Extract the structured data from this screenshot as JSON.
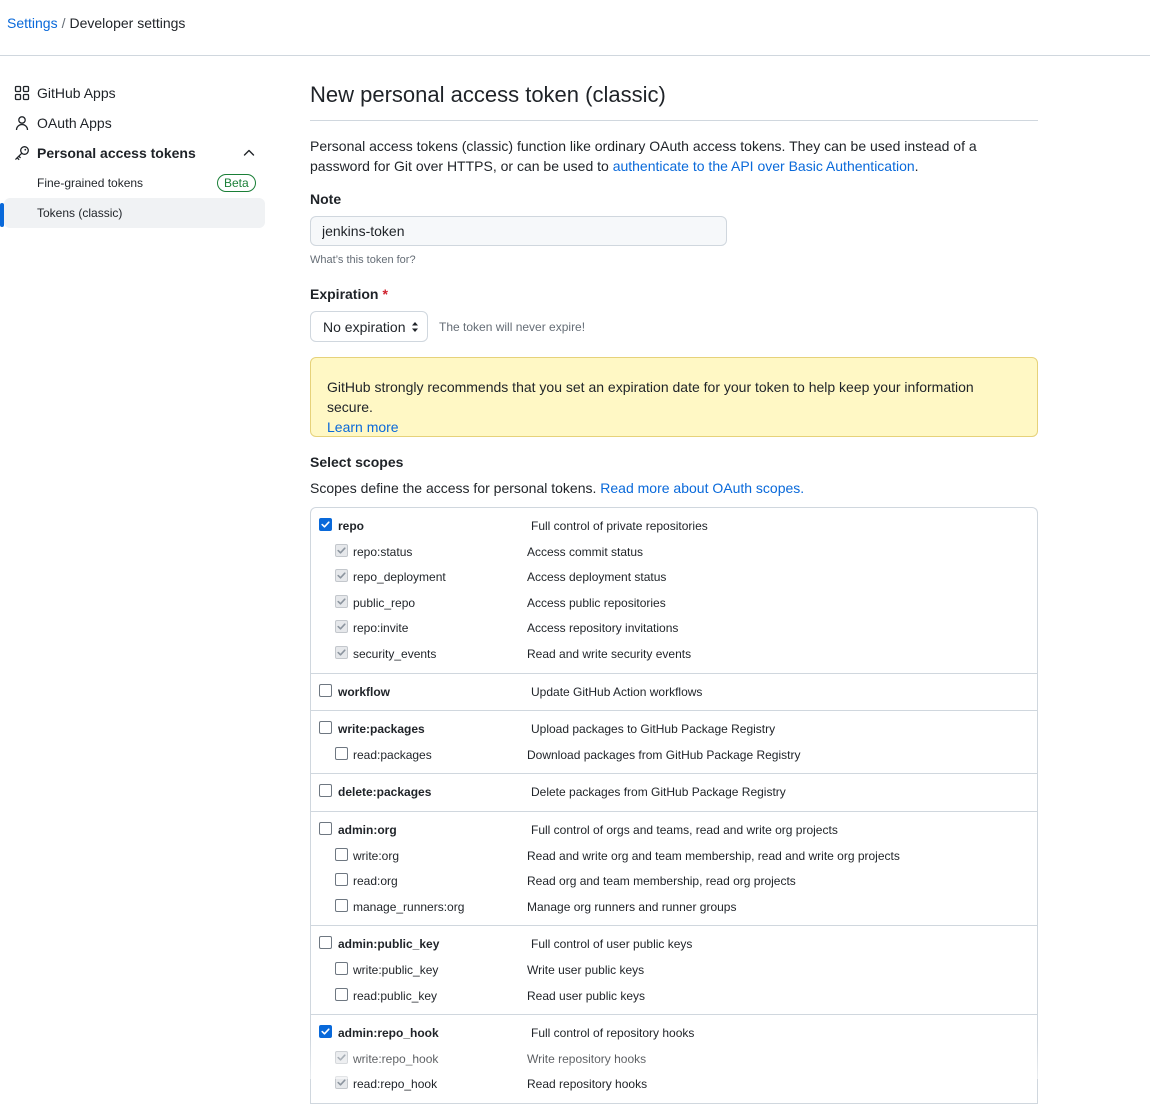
{
  "breadcrumb": {
    "root": "Settings",
    "separator": "/",
    "current": "Developer settings"
  },
  "sidebar": {
    "items": [
      {
        "label": "GitHub Apps",
        "icon": "apps-grid-icon"
      },
      {
        "label": "OAuth Apps",
        "icon": "person-icon"
      },
      {
        "label": "Personal access tokens",
        "icon": "key-icon"
      }
    ],
    "sub_items": [
      {
        "label": "Fine-grained tokens",
        "badge": "Beta"
      },
      {
        "label": "Tokens (classic)"
      }
    ]
  },
  "main": {
    "title": "New personal access token (classic)",
    "intro_text": "Personal access tokens (classic) function like ordinary OAuth access tokens. They can be used instead of a password for Git over HTTPS, or can be used to ",
    "intro_link": "authenticate to the API over Basic Authentication",
    "intro_end": ".",
    "note_label": "Note",
    "note_value": "jenkins-token",
    "note_hint": "What’s this token for?",
    "expiration_label": "Expiration",
    "expiration_required": "*",
    "expiration_value": "No expiration",
    "expiration_note": "The token will never expire!",
    "flash_text": "GitHub strongly recommends that you set an expiration date for your token to help keep your information secure.",
    "flash_link": "Learn more",
    "scopes_title": "Select scopes",
    "scopes_desc": "Scopes define the access for personal tokens. ",
    "scopes_link": "Read more about OAuth scopes."
  },
  "scope_groups": [
    {
      "name": "repo",
      "desc": "Full control of private repositories",
      "checked": true,
      "children": [
        {
          "name": "repo:status",
          "desc": "Access commit status",
          "checked": true
        },
        {
          "name": "repo_deployment",
          "desc": "Access deployment status",
          "checked": true
        },
        {
          "name": "public_repo",
          "desc": "Access public repositories",
          "checked": true
        },
        {
          "name": "repo:invite",
          "desc": "Access repository invitations",
          "checked": true
        },
        {
          "name": "security_events",
          "desc": "Read and write security events",
          "checked": true
        }
      ]
    },
    {
      "name": "workflow",
      "desc": "Update GitHub Action workflows",
      "checked": false,
      "children": []
    },
    {
      "name": "write:packages",
      "desc": "Upload packages to GitHub Package Registry",
      "checked": false,
      "children": [
        {
          "name": "read:packages",
          "desc": "Download packages from GitHub Package Registry",
          "checked": false
        }
      ]
    },
    {
      "name": "delete:packages",
      "desc": "Delete packages from GitHub Package Registry",
      "checked": false,
      "children": []
    },
    {
      "name": "admin:org",
      "desc": "Full control of orgs and teams, read and write org projects",
      "checked": false,
      "children": [
        {
          "name": "write:org",
          "desc": "Read and write org and team membership, read and write org projects",
          "checked": false
        },
        {
          "name": "read:org",
          "desc": "Read org and team membership, read org projects",
          "checked": false
        },
        {
          "name": "manage_runners:org",
          "desc": "Manage org runners and runner groups",
          "checked": false
        }
      ]
    },
    {
      "name": "admin:public_key",
      "desc": "Full control of user public keys",
      "checked": false,
      "children": [
        {
          "name": "write:public_key",
          "desc": "Write user public keys",
          "checked": false
        },
        {
          "name": "read:public_key",
          "desc": "Read user public keys",
          "checked": false
        }
      ]
    },
    {
      "name": "admin:repo_hook",
      "desc": "Full control of repository hooks",
      "checked": true,
      "children": [
        {
          "name": "write:repo_hook",
          "desc": "Write repository hooks",
          "checked": true
        },
        {
          "name": "read:repo_hook",
          "desc": "Read repository hooks",
          "checked": true
        }
      ]
    }
  ],
  "colors": {
    "accent": "#0969da",
    "border": "#d0d7de",
    "flash_bg": "#fff8c5",
    "success": "#1a7f37",
    "danger": "#cf222e"
  }
}
